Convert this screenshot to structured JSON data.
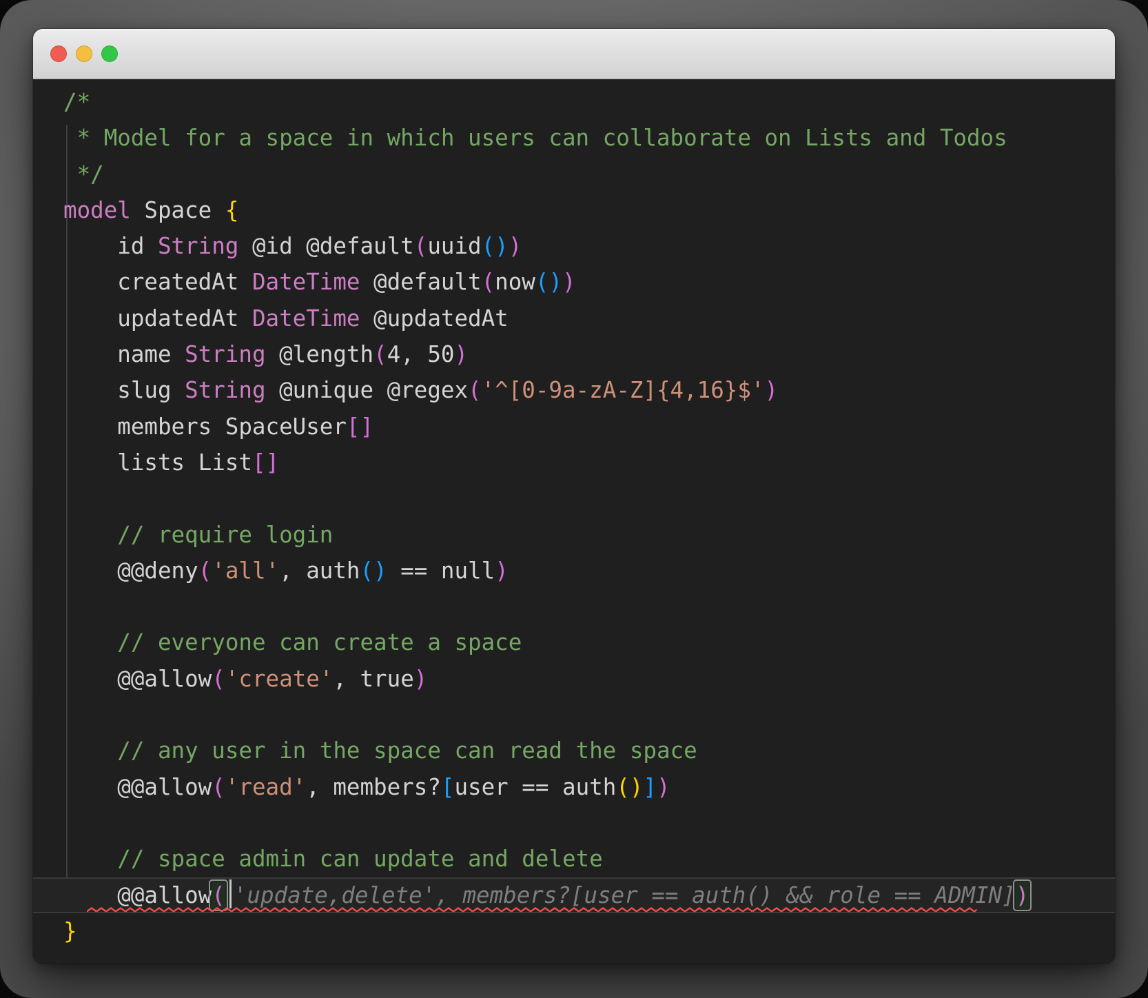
{
  "window": {
    "title": "",
    "titlebar_buttons": [
      {
        "name": "close",
        "color": "#F05C51"
      },
      {
        "name": "minimize",
        "color": "#F6BE3F"
      },
      {
        "name": "zoom",
        "color": "#33C748"
      }
    ]
  },
  "theme": {
    "backdrop": "#6E6E6E",
    "editor_bg": "#1F1F1F",
    "titlebar_top": "#ECECEC",
    "titlebar_bottom": "#D2D2D2",
    "guide": "#3F3F3F",
    "squiggle": "#F14C4C",
    "current_line_bg": "#242424",
    "current_line_border": "#3A3A3A",
    "bracket_match_border": "#909090",
    "bracket_match_bg": "#20301F",
    "caret": "#C8C8C8",
    "tokens": {
      "p": "#D4D4D4",
      "k": "#CD7EC3",
      "c": "#74A763",
      "s": "#CE9178",
      "y": "#FFD602",
      "m": "#D670D6",
      "u": "#1B9FFF",
      "g": "#7E7E7E"
    }
  },
  "editor": {
    "language": "zmodel",
    "lines": [
      {
        "tokens": [
          {
            "t": "/*",
            "c": "c"
          }
        ]
      },
      {
        "tokens": [
          {
            "t": " * Model for a space in which users can collaborate on Lists and Todos",
            "c": "c"
          }
        ]
      },
      {
        "tokens": [
          {
            "t": " */",
            "c": "c"
          }
        ]
      },
      {
        "tokens": [
          {
            "t": "model",
            "c": "k"
          },
          {
            "t": " Space ",
            "c": "p"
          },
          {
            "t": "{",
            "c": "y"
          }
        ]
      },
      {
        "tokens": [
          {
            "t": "    id ",
            "c": "p"
          },
          {
            "t": "String",
            "c": "k"
          },
          {
            "t": " @id @default",
            "c": "p"
          },
          {
            "t": "(",
            "c": "m"
          },
          {
            "t": "uuid",
            "c": "p"
          },
          {
            "t": "()",
            "c": "u"
          },
          {
            "t": ")",
            "c": "m"
          }
        ]
      },
      {
        "tokens": [
          {
            "t": "    createdAt ",
            "c": "p"
          },
          {
            "t": "DateTime",
            "c": "k"
          },
          {
            "t": " @default",
            "c": "p"
          },
          {
            "t": "(",
            "c": "m"
          },
          {
            "t": "now",
            "c": "p"
          },
          {
            "t": "()",
            "c": "u"
          },
          {
            "t": ")",
            "c": "m"
          }
        ]
      },
      {
        "tokens": [
          {
            "t": "    updatedAt ",
            "c": "p"
          },
          {
            "t": "DateTime",
            "c": "k"
          },
          {
            "t": " @updatedAt",
            "c": "p"
          }
        ]
      },
      {
        "tokens": [
          {
            "t": "    name ",
            "c": "p"
          },
          {
            "t": "String",
            "c": "k"
          },
          {
            "t": " @length",
            "c": "p"
          },
          {
            "t": "(",
            "c": "m"
          },
          {
            "t": "4, 50",
            "c": "p"
          },
          {
            "t": ")",
            "c": "m"
          }
        ]
      },
      {
        "tokens": [
          {
            "t": "    slug ",
            "c": "p"
          },
          {
            "t": "String",
            "c": "k"
          },
          {
            "t": " @unique @regex",
            "c": "p"
          },
          {
            "t": "(",
            "c": "m"
          },
          {
            "t": "'^[0-9a-zA-Z]{4,16}$'",
            "c": "s"
          },
          {
            "t": ")",
            "c": "m"
          }
        ]
      },
      {
        "tokens": [
          {
            "t": "    members SpaceUser",
            "c": "p"
          },
          {
            "t": "[]",
            "c": "m"
          }
        ]
      },
      {
        "tokens": [
          {
            "t": "    lists List",
            "c": "p"
          },
          {
            "t": "[]",
            "c": "m"
          }
        ]
      },
      {
        "tokens": []
      },
      {
        "tokens": [
          {
            "t": "    ",
            "c": "p"
          },
          {
            "t": "// require login",
            "c": "c"
          }
        ]
      },
      {
        "tokens": [
          {
            "t": "    @@deny",
            "c": "p"
          },
          {
            "t": "(",
            "c": "m"
          },
          {
            "t": "'all'",
            "c": "s"
          },
          {
            "t": ", auth",
            "c": "p"
          },
          {
            "t": "()",
            "c": "u"
          },
          {
            "t": " == null",
            "c": "p"
          },
          {
            "t": ")",
            "c": "m"
          }
        ]
      },
      {
        "tokens": []
      },
      {
        "tokens": [
          {
            "t": "    ",
            "c": "p"
          },
          {
            "t": "// everyone can create a space",
            "c": "c"
          }
        ]
      },
      {
        "tokens": [
          {
            "t": "    @@allow",
            "c": "p"
          },
          {
            "t": "(",
            "c": "m"
          },
          {
            "t": "'create'",
            "c": "s"
          },
          {
            "t": ", true",
            "c": "p"
          },
          {
            "t": ")",
            "c": "m"
          }
        ]
      },
      {
        "tokens": []
      },
      {
        "tokens": [
          {
            "t": "    ",
            "c": "p"
          },
          {
            "t": "// any user in the space can read the space",
            "c": "c"
          }
        ]
      },
      {
        "tokens": [
          {
            "t": "    @@allow",
            "c": "p"
          },
          {
            "t": "(",
            "c": "m"
          },
          {
            "t": "'read'",
            "c": "s"
          },
          {
            "t": ", members?",
            "c": "p"
          },
          {
            "t": "[",
            "c": "u"
          },
          {
            "t": "user == auth",
            "c": "p"
          },
          {
            "t": "()",
            "c": "y"
          },
          {
            "t": "]",
            "c": "u"
          },
          {
            "t": ")",
            "c": "m"
          }
        ]
      },
      {
        "tokens": []
      },
      {
        "tokens": [
          {
            "t": "    ",
            "c": "p"
          },
          {
            "t": "// space admin can update and delete",
            "c": "c"
          }
        ]
      },
      {
        "current": true,
        "squiggle": {
          "start": 4,
          "len": 66
        },
        "tokens": [
          {
            "t": "    @@allow",
            "c": "p"
          },
          {
            "t": "(",
            "c": "m",
            "box": true
          },
          {
            "caret": true
          },
          {
            "t": "'update,delete', members?[user == auth() && role == ADMIN]",
            "c": "g"
          },
          {
            "t": ")",
            "c": "m",
            "box": true
          }
        ]
      },
      {
        "tokens": [
          {
            "t": "}",
            "c": "y"
          }
        ]
      }
    ]
  }
}
